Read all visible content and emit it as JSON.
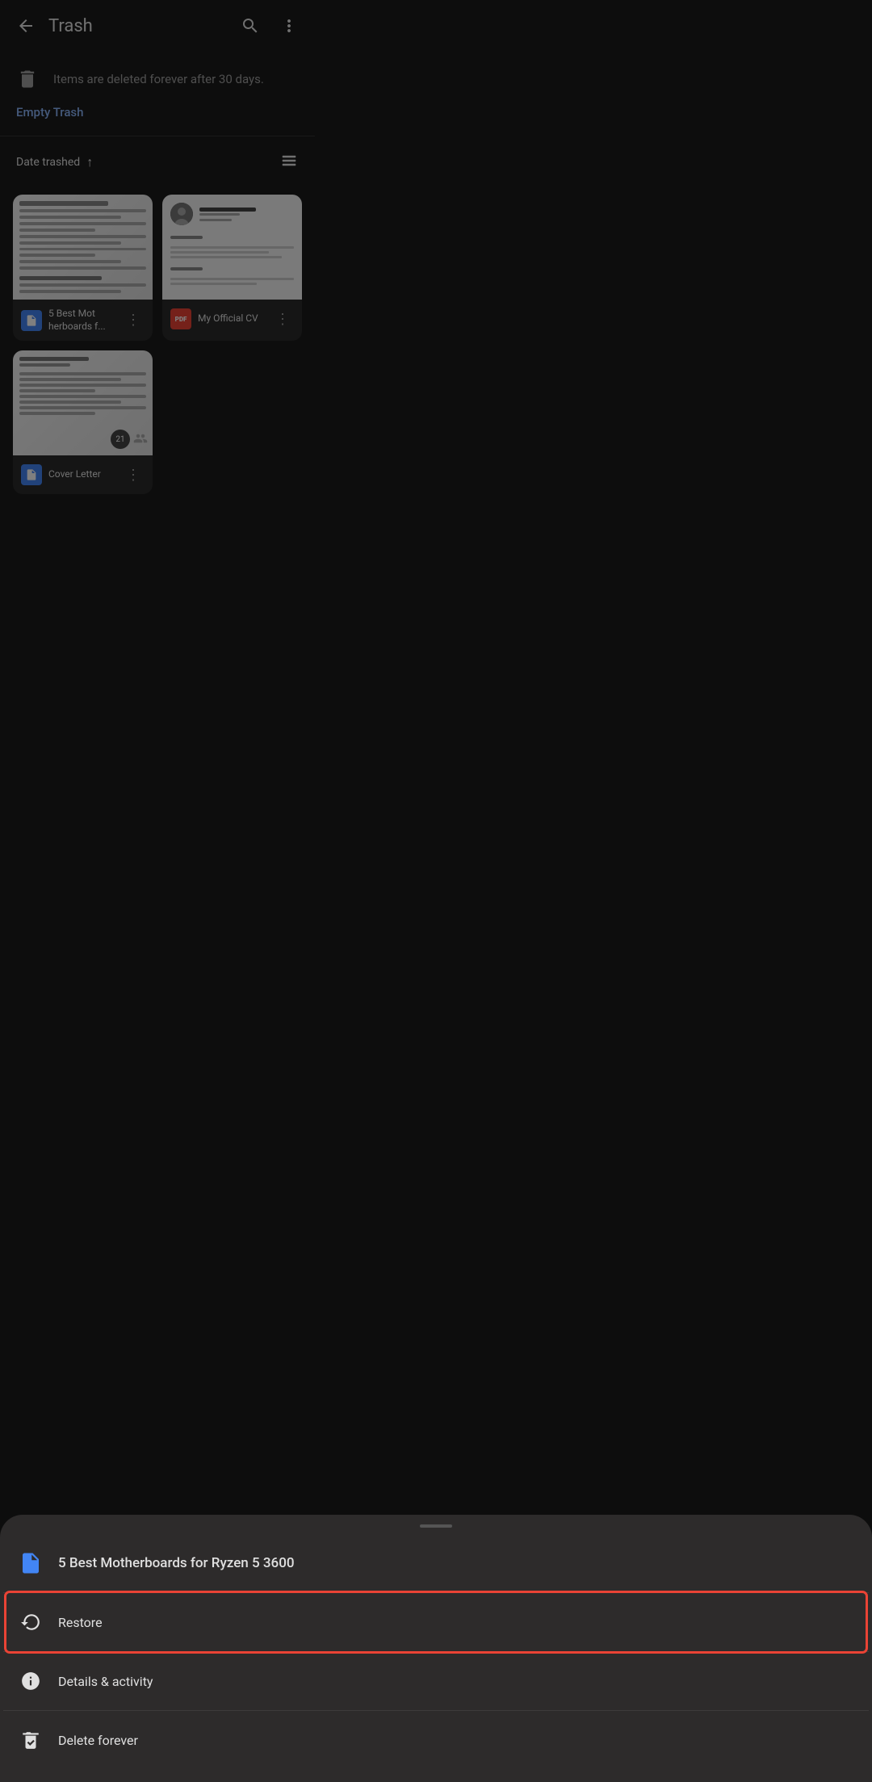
{
  "header": {
    "title": "Trash",
    "back_label": "Back",
    "search_label": "Search",
    "more_label": "More options"
  },
  "info_banner": {
    "message": "Items are deleted forever after 30 days.",
    "empty_trash_label": "Empty Trash"
  },
  "sort": {
    "label": "Date trashed",
    "direction": "ascending",
    "list_view_label": "List view"
  },
  "files": [
    {
      "id": "1",
      "name": "5 Best Mot herboards f...",
      "full_name": "5 Best Motherboards for Ryzen 5 3600",
      "type": "doc",
      "type_label": "DOC"
    },
    {
      "id": "2",
      "name": "My Official CV",
      "full_name": "My Official CV",
      "type": "pdf",
      "type_label": "PDF"
    },
    {
      "id": "3",
      "name": "Cover Letter",
      "full_name": "Cover Letter",
      "type": "doc",
      "type_label": "DOC",
      "badge": "21"
    }
  ],
  "bottom_sheet": {
    "selected_file": "5 Best Motherboards for Ryzen 5 3600",
    "menu_items": [
      {
        "id": "restore",
        "label": "Restore",
        "icon": "restore-icon",
        "highlighted": true
      },
      {
        "id": "details",
        "label": "Details & activity",
        "icon": "info-icon",
        "highlighted": false
      },
      {
        "id": "delete",
        "label": "Delete forever",
        "icon": "delete-forever-icon",
        "highlighted": false
      }
    ]
  }
}
